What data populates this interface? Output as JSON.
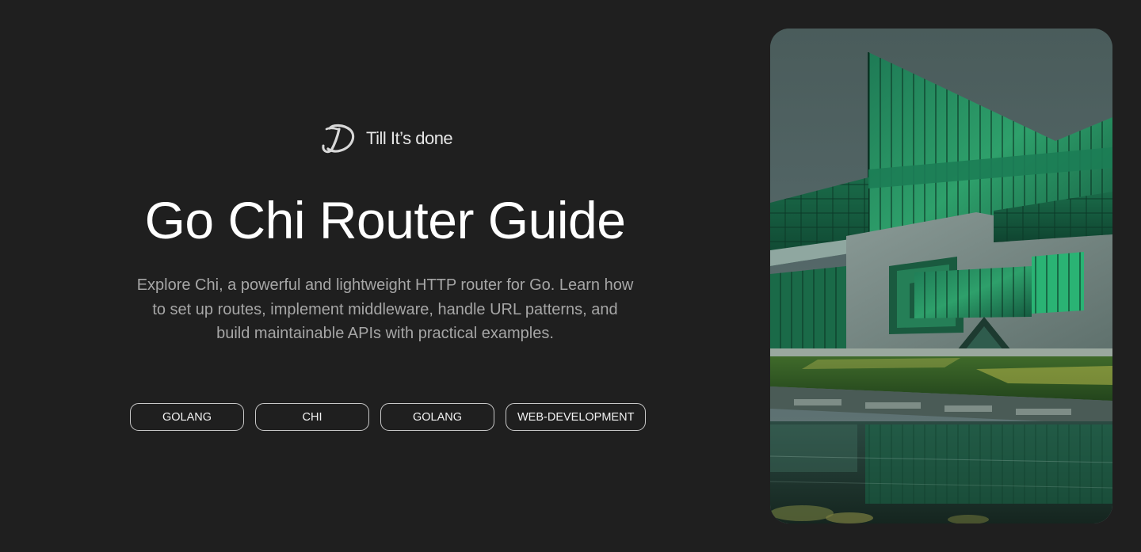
{
  "brand": {
    "logo_icon": "signature-td-logo-icon",
    "name": "Till It’s done"
  },
  "hero": {
    "title": "Go Chi Router Guide",
    "description": "Explore Chi, a powerful and lightweight HTTP router for Go. Learn how to set up routes, implement middleware, handle URL patterns, and build maintainable APIs with practical examples."
  },
  "tags": [
    {
      "label": "GOLANG"
    },
    {
      "label": "CHI"
    },
    {
      "label": "GOLANG"
    },
    {
      "label": "WEB-DEVELOPMENT"
    }
  ],
  "image": {
    "alt_subject": "green glass modern architecture building"
  },
  "colors": {
    "background": "#1f1f1f",
    "title": "#ffffff",
    "description": "#a6a6a6",
    "tag_border": "#c8c8c8",
    "accent_green": "#1f8f5a"
  }
}
